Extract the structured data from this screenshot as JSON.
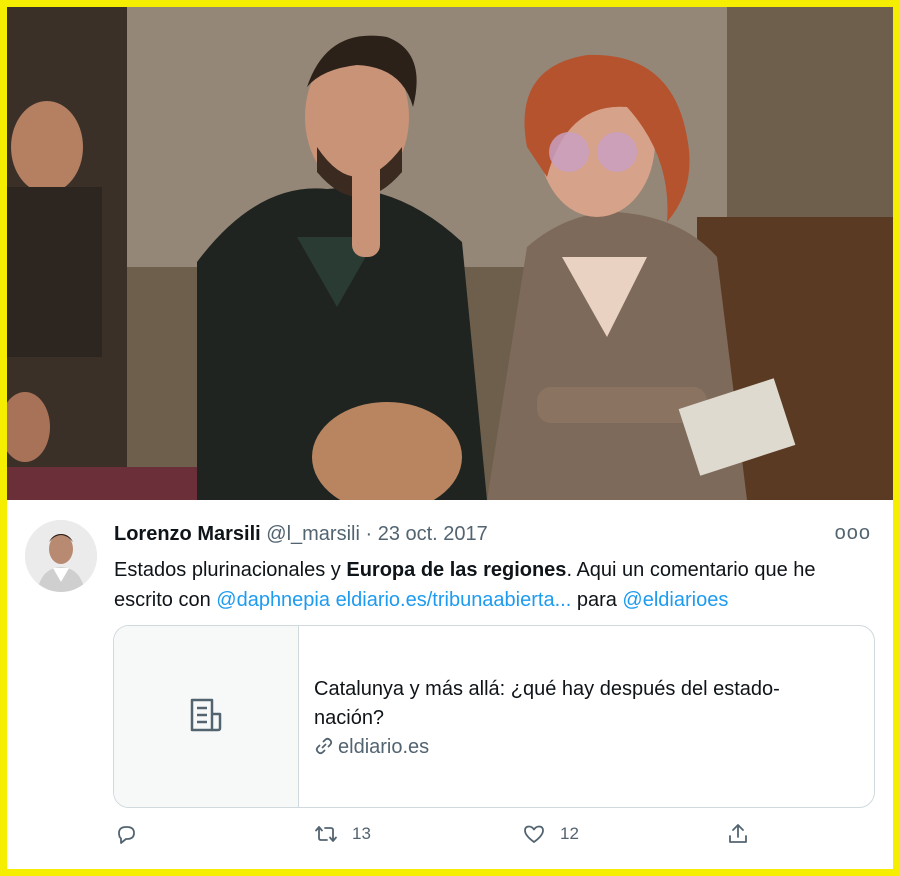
{
  "tweet": {
    "author_name": "Lorenzo Marsili",
    "handle": "@l_marsili",
    "separator": " · ",
    "date": "23 oct. 2017",
    "more_label": "ooo",
    "text": {
      "t1": "Estados plurinacionales y ",
      "bold": "Europa de las regiones",
      "t2": ". Aqui un comentario que he escrito con ",
      "mention1": "@daphnepia",
      "space1": " ",
      "url": "eldiario.es/tribunaabierta...",
      "t3": " para ",
      "mention2": "@eldiarioes"
    },
    "card": {
      "title": "Catalunya y más allá: ¿qué hay después del estado-nación?",
      "domain": "eldiario.es",
      "thumb_icon": "document-icon"
    },
    "actions": {
      "reply": {
        "icon": "reply-icon",
        "count": ""
      },
      "retweet": {
        "icon": "retweet-icon",
        "count": "13"
      },
      "like": {
        "icon": "heart-icon",
        "count": "12"
      },
      "share": {
        "icon": "share-icon",
        "count": ""
      }
    }
  },
  "colors": {
    "frame": "#f6ee00",
    "link": "#1d9bf0",
    "muted": "#536471",
    "text": "#0f1419"
  }
}
